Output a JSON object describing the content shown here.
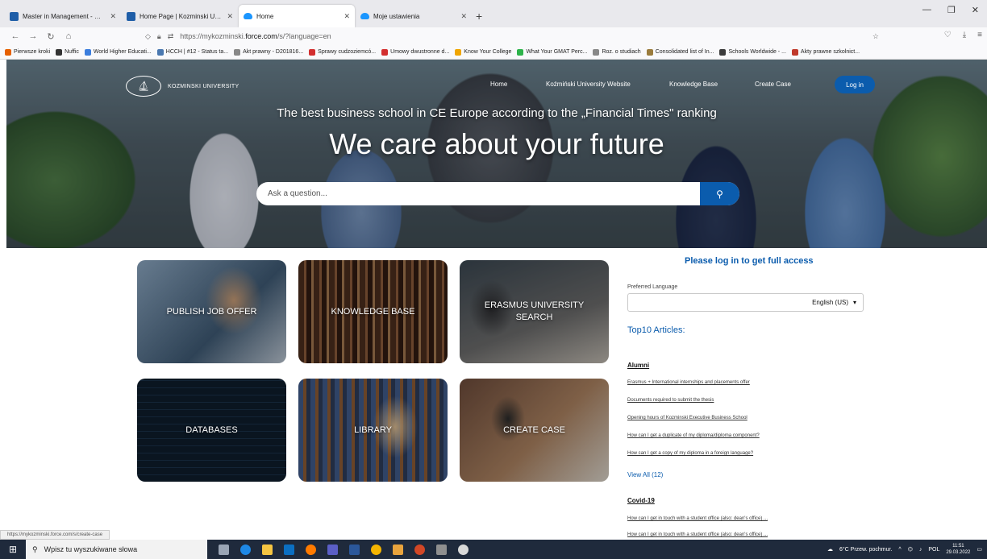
{
  "browser": {
    "tabs": [
      {
        "title": "Master in Management - Maste",
        "active": false
      },
      {
        "title": "Home Page | Kozminski Univer",
        "active": false
      },
      {
        "title": "Home",
        "active": true
      },
      {
        "title": "Moje ustawienia",
        "active": false
      }
    ],
    "url_prefix": "https://mykozminski.",
    "url_domain": "force.com",
    "url_suffix": "/s/?language=en",
    "bookmarks": [
      {
        "label": "Pierwsze kroki",
        "color": "#e66000"
      },
      {
        "label": "Nuffic",
        "color": "#333333"
      },
      {
        "label": "World Higher Educati...",
        "color": "#3b7ddd"
      },
      {
        "label": "HCCH | #12 - Status ta...",
        "color": "#4a78b0"
      },
      {
        "label": "Akt prawny - D201816...",
        "color": "#888888"
      },
      {
        "label": "Sprawy cudzoziemcó...",
        "color": "#d32f2f"
      },
      {
        "label": "Umowy dwustronne d...",
        "color": "#d32f2f"
      },
      {
        "label": "Know Your College",
        "color": "#f0a500"
      },
      {
        "label": "What Your GMAT Perc...",
        "color": "#2db34a"
      },
      {
        "label": "Roz. o studiach",
        "color": "#888888"
      },
      {
        "label": "Consolidated list of In...",
        "color": "#9a7b3c"
      },
      {
        "label": "Schools Worldwide - ...",
        "color": "#3b3b3b"
      },
      {
        "label": "Akty prawne szkolnict...",
        "color": "#c0392b"
      }
    ]
  },
  "hero": {
    "brand": "KOZMINSKI UNIVERSITY",
    "nav": [
      "Home",
      "Koźmiński University Website",
      "Knowledge Base",
      "Create Case"
    ],
    "login_label": "Log in",
    "subheadline": "The best business school in CE Europe according to the „Financial Times\" ranking",
    "headline": "We care about your future",
    "search_placeholder": "Ask a question..."
  },
  "tiles": [
    "PUBLISH JOB OFFER",
    "KNOWLEDGE BASE",
    "ERASMUS UNIVERSITY SEARCH",
    "DATABASES",
    "LIBRARY",
    "CREATE CASE"
  ],
  "sidebar": {
    "login_prompt": "Please log in to get full access",
    "language_label": "Preferred Language",
    "language_value": "English (US)",
    "top10_title": "Top10 Articles:",
    "sections": [
      {
        "title": "Alumni",
        "articles": [
          "Erasmus + International internships and placements offer",
          "Documents required to submit the thesis",
          "Opening hours of Kozminski Executive Business School",
          "How can I get a duplicate of my diploma/diploma component?",
          "How can I get a copy of my diploma in a foreign language?"
        ],
        "view_all": "View All (12)"
      },
      {
        "title": "Covid-19",
        "articles": [
          "How can I get in touch with a student office (also: dean's office) ...",
          "How can I get in touch with a student office (also: dean's office) ..."
        ]
      }
    ]
  },
  "status_url": "https://mykozminski.force.com/s/create-case",
  "taskbar": {
    "search_placeholder": "Wpisz tu wyszukiwane słowa",
    "weather": "6°C  Przew. pochmur.",
    "lang": "POL",
    "time": "11:51",
    "date": "29.03.2022"
  }
}
